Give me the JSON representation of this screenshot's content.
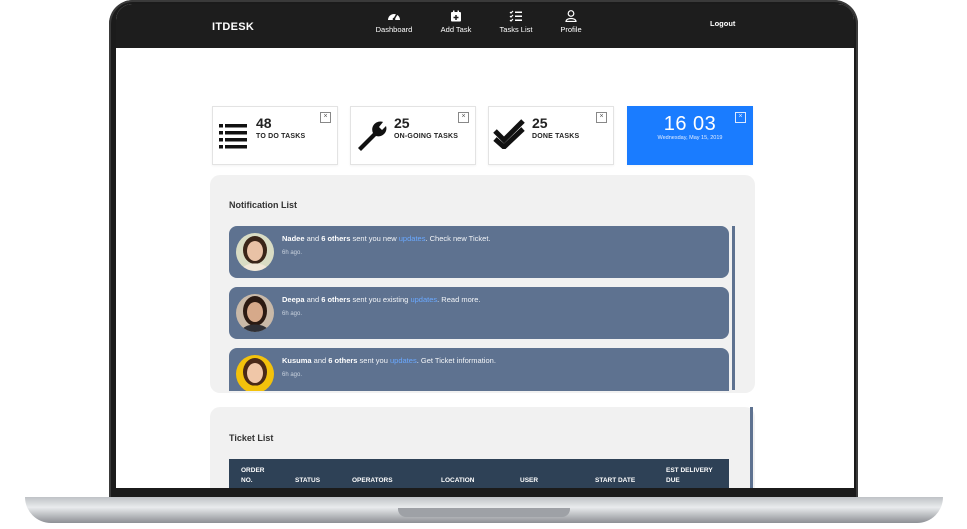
{
  "nav": {
    "brand": "ITDESK",
    "items": [
      {
        "label": "Dashboard",
        "icon": "speedometer-icon"
      },
      {
        "label": "Add Task",
        "icon": "calendar-plus-icon"
      },
      {
        "label": "Tasks List",
        "icon": "checklist-icon"
      },
      {
        "label": "Profile",
        "icon": "user-icon"
      }
    ],
    "logout": "Logout"
  },
  "stats": [
    {
      "value": "48",
      "label": "TO DO TASKS",
      "icon": "list-icon"
    },
    {
      "value": "25",
      "label": "ON-GOING TASKS",
      "icon": "wrench-icon"
    },
    {
      "value": "25",
      "label": "DONE TASKS",
      "icon": "double-check-icon"
    }
  ],
  "close_glyph": "×",
  "clock": {
    "time": "16 03",
    "date": "Wednesday, May 15, 2019"
  },
  "notifications": {
    "title": "Notification List",
    "items": [
      {
        "name": "Nadee",
        "mid": " and ",
        "others": "6 others",
        "pre": " sent you new ",
        "link": "updates",
        "post": ". Check new Ticket.",
        "time": "6h ago."
      },
      {
        "name": "Deepa",
        "mid": " and ",
        "others": "6 others",
        "pre": " sent you existing ",
        "link": "updates",
        "post": ". Read more.",
        "time": "6h ago."
      },
      {
        "name": "Kusuma",
        "mid": " and ",
        "others": "6 others",
        "pre": " sent you ",
        "link": "updates",
        "post": ". Get Ticket information.",
        "time": "6h ago."
      }
    ]
  },
  "tickets": {
    "title": "Ticket List",
    "columns": [
      {
        "line1": "ORDER",
        "line2": "NO."
      },
      {
        "line1": "",
        "line2": "STATUS"
      },
      {
        "line1": "",
        "line2": "OPERATORS"
      },
      {
        "line1": "",
        "line2": "LOCATION"
      },
      {
        "line1": "",
        "line2": "USER"
      },
      {
        "line1": "",
        "line2": "START DATE"
      },
      {
        "line1": "EST DELIVERY",
        "line2": "DUE"
      }
    ]
  },
  "colors": {
    "accent": "#1a7cff",
    "notification_bg": "#5e7290",
    "nav_bg": "#1d1d1d",
    "table_header": "#2e4156"
  }
}
